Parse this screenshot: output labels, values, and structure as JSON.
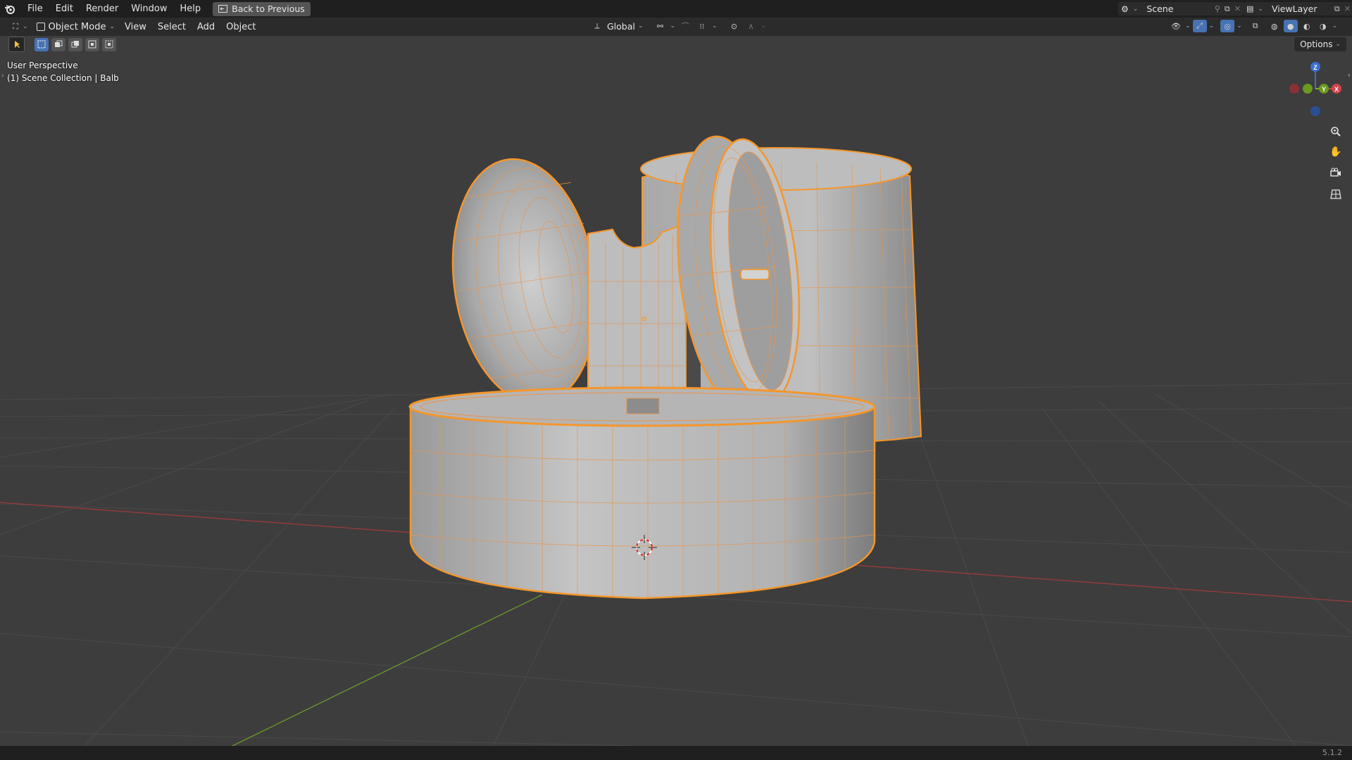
{
  "topbar": {
    "menus": [
      "File",
      "Edit",
      "Render",
      "Window",
      "Help"
    ],
    "back_label": "Back to Previous",
    "scene_name": "Scene",
    "view_layer": "ViewLayer"
  },
  "header": {
    "mode": "Object Mode",
    "menus": [
      "View",
      "Select",
      "Add",
      "Object"
    ],
    "orientation": "Global",
    "options_label": "Options"
  },
  "viewport": {
    "perspective_label": "User Perspective",
    "collection_label": "(1) Scene Collection | Balb",
    "object_color": "#f5962a",
    "gizmo": {
      "z": "Z",
      "y": "Y",
      "x": "X"
    }
  },
  "status": {
    "version": "5.1.2"
  }
}
